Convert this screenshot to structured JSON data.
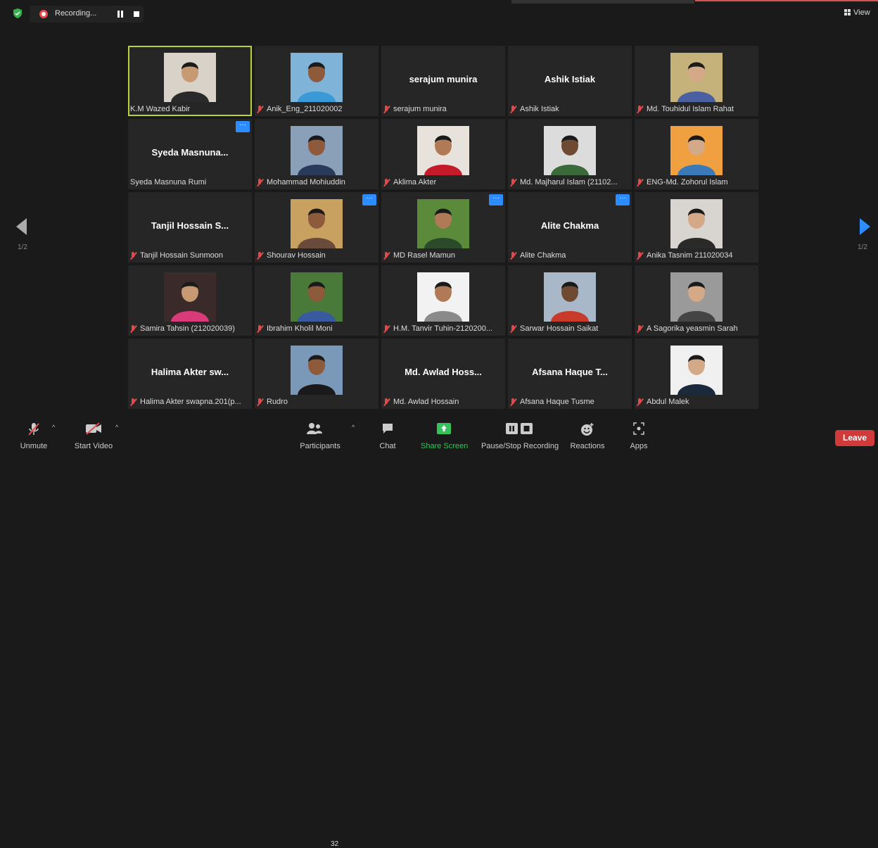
{
  "recording": {
    "label": "Recording..."
  },
  "view_button": {
    "label": "View"
  },
  "page_indicator": {
    "left": "1/2",
    "right": "1/2"
  },
  "participants": [
    {
      "name": "K.M Wazed Kabir",
      "display": "",
      "photo": "man-suit",
      "muted": false,
      "active": true,
      "more": false
    },
    {
      "name": "Anik_Eng_211020002",
      "display": "",
      "photo": "man-sunglasses-beach",
      "muted": true,
      "active": false,
      "more": false
    },
    {
      "name": "serajum munira",
      "display": "serajum munira",
      "photo": "",
      "muted": true,
      "active": false,
      "more": false
    },
    {
      "name": "Ashik Istiak",
      "display": "Ashik Istiak",
      "photo": "",
      "muted": true,
      "active": false,
      "more": false
    },
    {
      "name": "Md. Touhidul Islam Rahat",
      "display": "",
      "photo": "young-man",
      "muted": true,
      "active": false,
      "more": false
    },
    {
      "name": "Syeda Masnuna Rumi",
      "display": "Syeda Masnuna...",
      "photo": "",
      "muted": false,
      "active": false,
      "more": true
    },
    {
      "name": "Mohammad Mohiuddin",
      "display": "",
      "photo": "man-beard",
      "muted": true,
      "active": false,
      "more": false
    },
    {
      "name": "Aklima Akter",
      "display": "",
      "photo": "woman-hijab-red",
      "muted": true,
      "active": false,
      "more": false
    },
    {
      "name": "Md. Majharul Islam (21102...",
      "display": "",
      "photo": "man-shirt",
      "muted": true,
      "active": false,
      "more": false
    },
    {
      "name": "ENG-Md. Zohorul Islam",
      "display": "",
      "photo": "man-portrait",
      "muted": true,
      "active": false,
      "more": false
    },
    {
      "name": "Tanjil Hossain Sunmoon",
      "display": "Tanjil Hossain S...",
      "photo": "",
      "muted": true,
      "active": false,
      "more": false
    },
    {
      "name": "Shourav Hossain",
      "display": "",
      "photo": "man-hand-chin",
      "muted": true,
      "active": false,
      "more": true
    },
    {
      "name": "MD Rasel Mamun",
      "display": "",
      "photo": "man-greenery",
      "muted": true,
      "active": false,
      "more": true
    },
    {
      "name": "Alite Chakma",
      "display": "Alite Chakma",
      "photo": "",
      "muted": true,
      "active": false,
      "more": true
    },
    {
      "name": "Anika Tasnim 211020034",
      "display": "",
      "photo": "woman-long-hair",
      "muted": true,
      "active": false,
      "more": false
    },
    {
      "name": "Samira Tahsin (212020039)",
      "display": "",
      "photo": "woman-dark",
      "muted": true,
      "active": false,
      "more": false
    },
    {
      "name": "Ibrahim Kholil Moni",
      "display": "",
      "photo": "man-trees",
      "muted": true,
      "active": false,
      "more": false
    },
    {
      "name": "H.M. Tanvir Tuhin-2120200...",
      "display": "",
      "photo": "man-white-bg",
      "muted": true,
      "active": false,
      "more": false
    },
    {
      "name": "Sarwar Hossain Saikat",
      "display": "",
      "photo": "man-city",
      "muted": true,
      "active": false,
      "more": false
    },
    {
      "name": "A Sagorika yeasmin Sarah",
      "display": "",
      "photo": "woman-bw",
      "muted": true,
      "active": false,
      "more": false
    },
    {
      "name": "Halima Akter swapna.201(p...",
      "display": "Halima Akter sw...",
      "photo": "",
      "muted": true,
      "active": false,
      "more": false
    },
    {
      "name": "Rudro",
      "display": "",
      "photo": "man-cap",
      "muted": true,
      "active": false,
      "more": false
    },
    {
      "name": "Md. Awlad Hossain",
      "display": "Md. Awlad Hoss...",
      "photo": "",
      "muted": true,
      "active": false,
      "more": false
    },
    {
      "name": "Afsana Haque Tusme",
      "display": "Afsana Haque T...",
      "photo": "",
      "muted": true,
      "active": false,
      "more": false
    },
    {
      "name": "Abdul Malek",
      "display": "",
      "photo": "man-suit-beard",
      "muted": true,
      "active": false,
      "more": false
    }
  ],
  "more_label": "···",
  "toolbar": {
    "unmute": "Unmute",
    "start_video": "Start Video",
    "participants": "Participants",
    "participants_count": "32",
    "chat": "Chat",
    "share_screen": "Share Screen",
    "pause_stop_recording": "Pause/Stop Recording",
    "reactions": "Reactions",
    "apps": "Apps",
    "leave": "Leave"
  },
  "colors": {
    "accent": "#2d8cff",
    "active_border": "#b6d33b",
    "leave": "#d13a3a",
    "share": "#36c25a",
    "muted": "#e04b4b"
  }
}
